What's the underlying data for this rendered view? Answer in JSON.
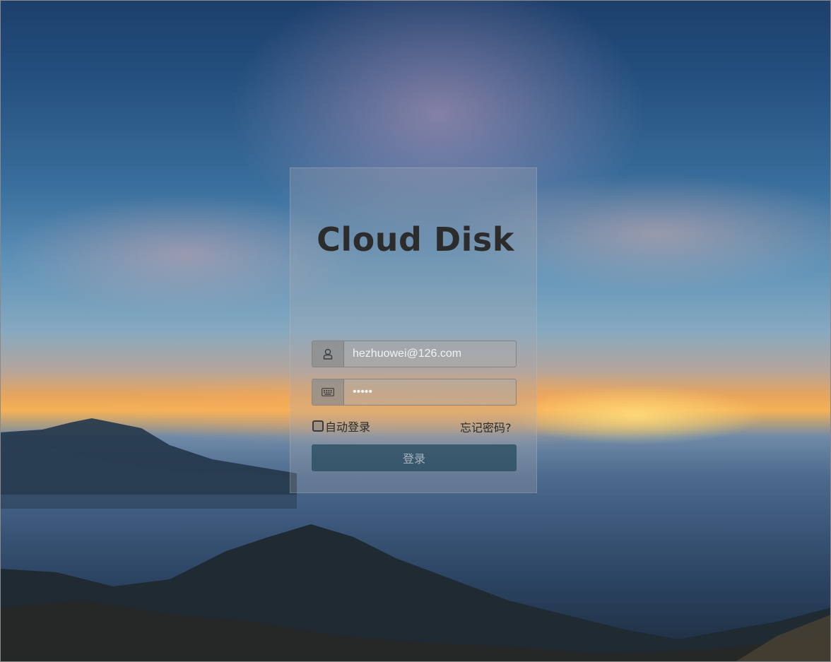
{
  "app": {
    "title": "Cloud Disk"
  },
  "login": {
    "email_value": "hezhuowei@126.com",
    "password_value": "•••••",
    "remember_label": "自动登录",
    "remember_checked": false,
    "forgot_label": "忘记密码?",
    "submit_label": "登录"
  },
  "icons": {
    "email": "user-icon",
    "password": "keyboard-icon"
  },
  "colors": {
    "button_bg": "#23465a",
    "title_text": "#2c2c2c"
  }
}
